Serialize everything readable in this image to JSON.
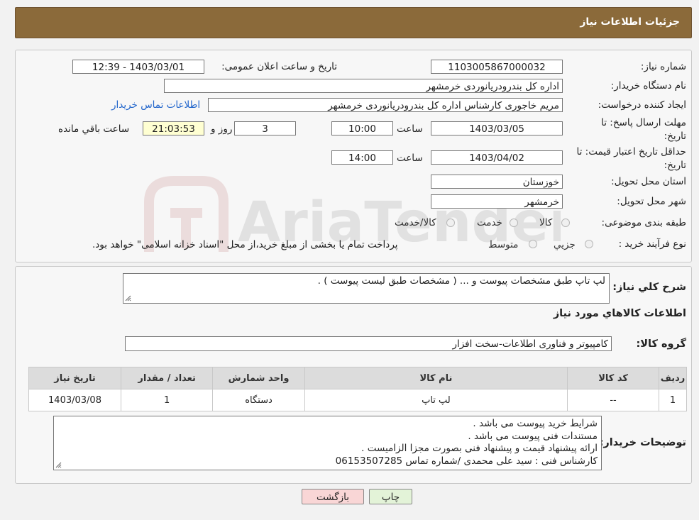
{
  "header": {
    "title": "جزئیات اطلاعات نیاز"
  },
  "form": {
    "need_number": {
      "label": "شماره نیاز:",
      "value": "1103005867000032"
    },
    "announce": {
      "label": "تاریخ و ساعت اعلان عمومی:",
      "value": "1403/03/01 - 12:39"
    },
    "buyer_org": {
      "label": "نام دستگاه خریدار:",
      "value": "اداره کل بندرودریانوردی خرمشهر"
    },
    "requester": {
      "label": "ایجاد کننده درخواست:",
      "value": "مریم خاجوری کارشناس اداره کل بندرودریانوردی خرمشهر",
      "contact_link": "اطلاعات تماس خریدار"
    },
    "reply_deadline": {
      "label_line1": "مهلت ارسال پاسخ: تا",
      "label_line2": "تاریخ:",
      "date": "1403/03/05",
      "time_label": "ساعت",
      "time": "10:00",
      "days": "3",
      "days_label": "روز و",
      "remaining": "21:03:53",
      "remaining_label": "ساعت باقي مانده"
    },
    "price_validity": {
      "label_line1": "حداقل تاریخ اعتبار قیمت: تا",
      "label_line2": "تاریخ:",
      "date": "1403/04/02",
      "time_label": "ساعت",
      "time": "14:00"
    },
    "province": {
      "label": "استان محل تحویل:",
      "value": "خوزستان"
    },
    "city": {
      "label": "شهر محل تحویل:",
      "value": "خرمشهر"
    },
    "category": {
      "label": "طبقه بندی موضوعی:",
      "options": [
        "کالا",
        "خدمت",
        "کالا/خدمت"
      ]
    },
    "process": {
      "label": "نوع فرآیند خرید :",
      "options": [
        "جزيي",
        "متوسط"
      ],
      "note": "پرداخت تمام یا بخشی از مبلغ خرید،از محل \"اسناد خزانه اسلامی\" خواهد بود."
    }
  },
  "summary": {
    "label": "شرح کلي نياز:",
    "value": "لپ تاپ طبق مشخصات پیوست و ... ( مشخصات طبق لیست پیوست ) ."
  },
  "goods": {
    "title": "اطلاعات کالاهاي مورد نياز",
    "group_label": "گروه کالا:",
    "group_value": "کامپیوتر و فناوری اطلاعات-سخت افزار",
    "columns": [
      "رديف",
      "کد کالا",
      "نام کالا",
      "واحد شمارش",
      "تعداد / مقدار",
      "تاريخ نياز"
    ],
    "rows": [
      [
        "1",
        "--",
        "لپ تاپ",
        "دستگاه",
        "1",
        "1403/03/08"
      ]
    ]
  },
  "buyer_notes": {
    "label": "توضيحات خريدار:",
    "lines": [
      "شرایط خرید پیوست می باشد .",
      "مستندات فنی پیوست می باشد .",
      "ارائه پیشنهاد قیمت و پیشنهاد فنی بصورت مجزا الزامیست .",
      "کارشناس فنی : سید علی محمدی /شماره تماس 06153507285"
    ]
  },
  "buttons": {
    "print": "چاپ",
    "back": "بازگشت"
  },
  "watermark": {
    "text": "AriaTender.neT"
  },
  "colors": {
    "header_bg": "#8b6a3a",
    "link": "#2266cc",
    "remaining_bg": "#ffffd2",
    "back_button_bg": "#f9d6d6",
    "print_button_bg": "#e3f3d8"
  }
}
